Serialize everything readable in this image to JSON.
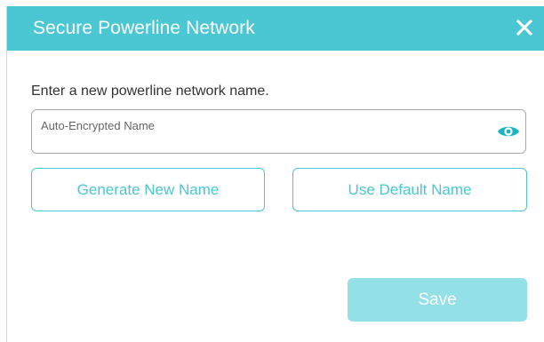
{
  "dialog": {
    "title": "Secure Powerline Network",
    "prompt": "Enter a new powerline network name.",
    "name_input": {
      "value": "",
      "placeholder": "Auto-Encrypted Name"
    },
    "generate_button_label": "Generate New Name",
    "default_button_label": "Use Default Name",
    "save_button_label": "Save",
    "save_enabled": false
  },
  "icons": {
    "close": "close-icon",
    "show_password": "eye-icon"
  },
  "colors": {
    "accent": "#4ac7d3",
    "save_disabled": "#93e0e6",
    "header_text": "#ffffff",
    "body_text": "#333333"
  }
}
